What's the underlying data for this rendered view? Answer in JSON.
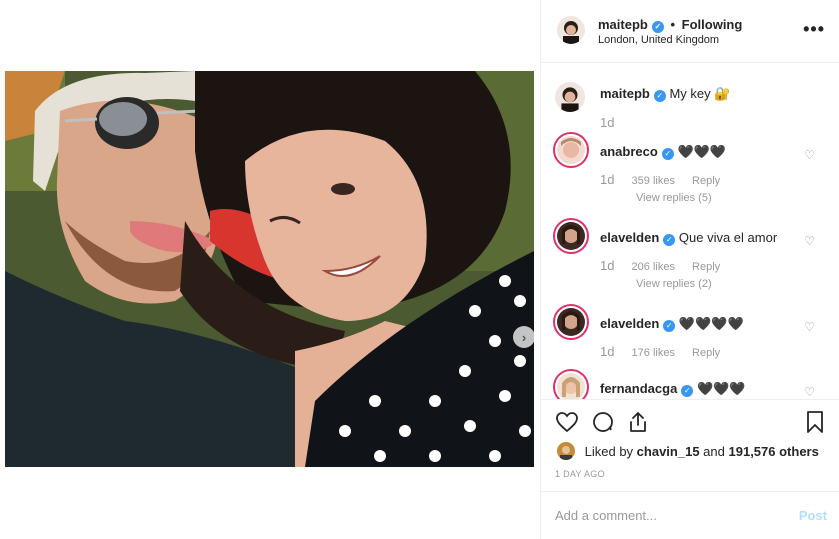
{
  "post": {
    "photo_alt": "",
    "carousel_next_icon": "chevron-right-icon"
  },
  "header": {
    "username": "maitepb",
    "separator": "•",
    "follow_status": "Following",
    "location": "London, United Kingdom",
    "more_icon": "more-options-icon",
    "more_label": "•••"
  },
  "caption": {
    "username": "maitepb",
    "text": "My key 🔐",
    "time": "1d"
  },
  "comments": [
    {
      "username": "anabreco",
      "text": "🖤🖤🖤",
      "time": "1d",
      "likes": "359 likes",
      "reply": "Reply",
      "view_replies": "View replies (5)"
    },
    {
      "username": "elavelden",
      "text": "Que viva el amor",
      "time": "1d",
      "likes": "206 likes",
      "reply": "Reply",
      "view_replies": "View replies (2)"
    },
    {
      "username": "elavelden",
      "text": "🖤🖤🖤🖤",
      "time": "1d",
      "likes": "176 likes",
      "reply": "Reply",
      "view_replies": ""
    },
    {
      "username": "fernandacga",
      "text": "🖤🖤🖤",
      "time": "",
      "likes": "",
      "reply": "",
      "view_replies": ""
    }
  ],
  "actions": {
    "like_icon": "heart-icon",
    "comment_icon": "comment-icon",
    "share_icon": "share-icon",
    "save_icon": "bookmark-icon"
  },
  "likes": {
    "prefix": "Liked by",
    "user": "chavin_15",
    "middle": "and",
    "count": "191,576 others"
  },
  "timestamp": "1 DAY AGO",
  "add_comment": {
    "placeholder": "Add a comment...",
    "post_label": "Post"
  },
  "colors": {
    "verified": "#3897f0",
    "post_button_disabled": "#b2dffc",
    "story_ring": "#e1306c",
    "muted_text": "#999999"
  }
}
